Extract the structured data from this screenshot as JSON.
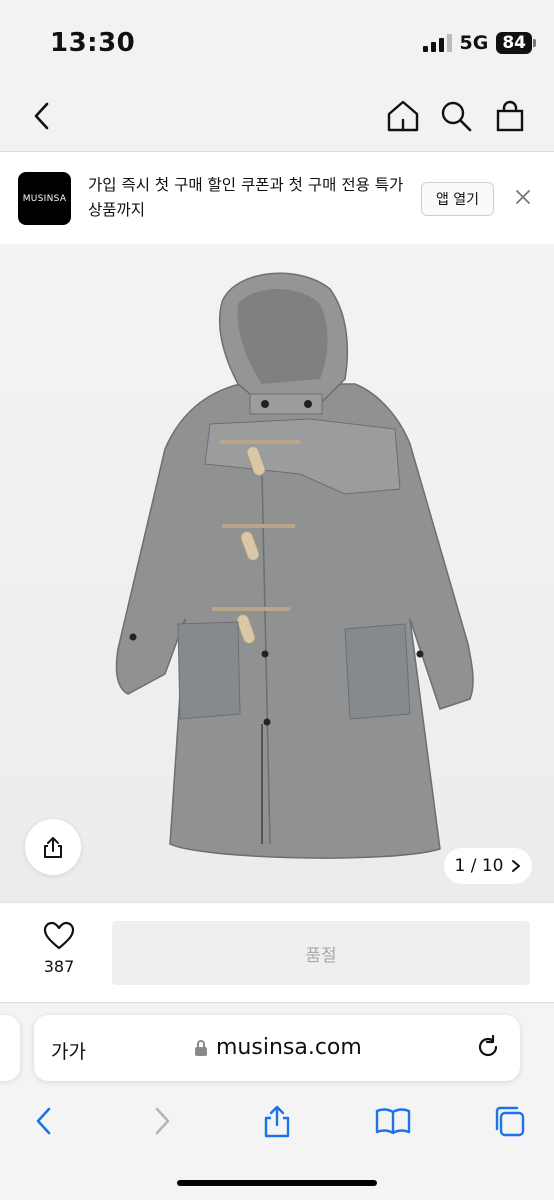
{
  "status": {
    "time": "13:30",
    "network": "5G",
    "battery": "84"
  },
  "banner": {
    "logo_text": "MUSINSA",
    "message": "가입 즉시 첫 구매 할인 쿠폰과 첫 구매 전용 특가 상품까지",
    "open_app_label": "앱 열기"
  },
  "product": {
    "page_indicator": "1 / 10",
    "like_count": "387",
    "soldout_label": "품절"
  },
  "browser": {
    "text_size_label": "가가",
    "url": "musinsa.com"
  },
  "icons": [
    "back-icon",
    "home-icon",
    "search-icon",
    "bag-icon",
    "close-icon",
    "share-icon",
    "chevron-right-icon",
    "heart-icon",
    "lock-icon",
    "reload-icon",
    "forward-icon",
    "bookmarks-icon",
    "tabs-icon"
  ],
  "colors": {
    "accent": "#1a73e8",
    "soldout_bg": "#efefef",
    "soldout_text": "#a8a8a8",
    "coat": "#8f9193"
  }
}
